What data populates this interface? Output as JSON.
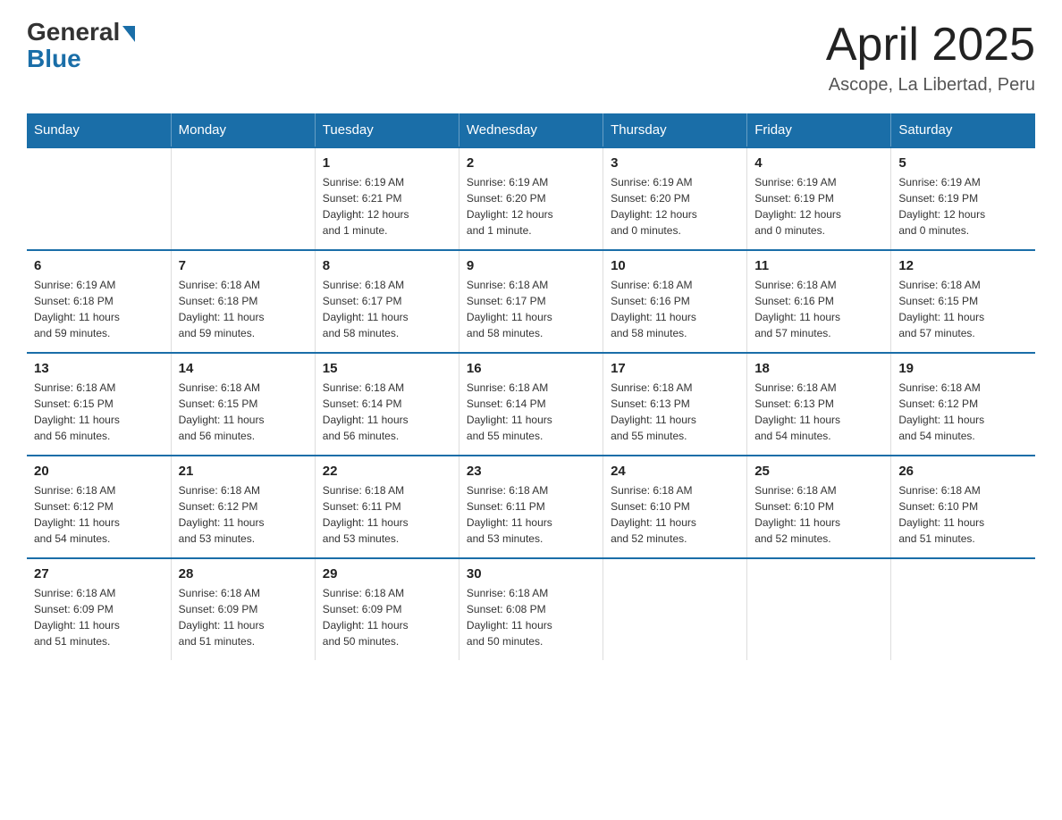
{
  "header": {
    "logo_general": "General",
    "logo_blue": "Blue",
    "month_title": "April 2025",
    "location": "Ascope, La Libertad, Peru"
  },
  "days_of_week": [
    "Sunday",
    "Monday",
    "Tuesday",
    "Wednesday",
    "Thursday",
    "Friday",
    "Saturday"
  ],
  "weeks": [
    [
      {
        "day": "",
        "info": ""
      },
      {
        "day": "",
        "info": ""
      },
      {
        "day": "1",
        "info": "Sunrise: 6:19 AM\nSunset: 6:21 PM\nDaylight: 12 hours\nand 1 minute."
      },
      {
        "day": "2",
        "info": "Sunrise: 6:19 AM\nSunset: 6:20 PM\nDaylight: 12 hours\nand 1 minute."
      },
      {
        "day": "3",
        "info": "Sunrise: 6:19 AM\nSunset: 6:20 PM\nDaylight: 12 hours\nand 0 minutes."
      },
      {
        "day": "4",
        "info": "Sunrise: 6:19 AM\nSunset: 6:19 PM\nDaylight: 12 hours\nand 0 minutes."
      },
      {
        "day": "5",
        "info": "Sunrise: 6:19 AM\nSunset: 6:19 PM\nDaylight: 12 hours\nand 0 minutes."
      }
    ],
    [
      {
        "day": "6",
        "info": "Sunrise: 6:19 AM\nSunset: 6:18 PM\nDaylight: 11 hours\nand 59 minutes."
      },
      {
        "day": "7",
        "info": "Sunrise: 6:18 AM\nSunset: 6:18 PM\nDaylight: 11 hours\nand 59 minutes."
      },
      {
        "day": "8",
        "info": "Sunrise: 6:18 AM\nSunset: 6:17 PM\nDaylight: 11 hours\nand 58 minutes."
      },
      {
        "day": "9",
        "info": "Sunrise: 6:18 AM\nSunset: 6:17 PM\nDaylight: 11 hours\nand 58 minutes."
      },
      {
        "day": "10",
        "info": "Sunrise: 6:18 AM\nSunset: 6:16 PM\nDaylight: 11 hours\nand 58 minutes."
      },
      {
        "day": "11",
        "info": "Sunrise: 6:18 AM\nSunset: 6:16 PM\nDaylight: 11 hours\nand 57 minutes."
      },
      {
        "day": "12",
        "info": "Sunrise: 6:18 AM\nSunset: 6:15 PM\nDaylight: 11 hours\nand 57 minutes."
      }
    ],
    [
      {
        "day": "13",
        "info": "Sunrise: 6:18 AM\nSunset: 6:15 PM\nDaylight: 11 hours\nand 56 minutes."
      },
      {
        "day": "14",
        "info": "Sunrise: 6:18 AM\nSunset: 6:15 PM\nDaylight: 11 hours\nand 56 minutes."
      },
      {
        "day": "15",
        "info": "Sunrise: 6:18 AM\nSunset: 6:14 PM\nDaylight: 11 hours\nand 56 minutes."
      },
      {
        "day": "16",
        "info": "Sunrise: 6:18 AM\nSunset: 6:14 PM\nDaylight: 11 hours\nand 55 minutes."
      },
      {
        "day": "17",
        "info": "Sunrise: 6:18 AM\nSunset: 6:13 PM\nDaylight: 11 hours\nand 55 minutes."
      },
      {
        "day": "18",
        "info": "Sunrise: 6:18 AM\nSunset: 6:13 PM\nDaylight: 11 hours\nand 54 minutes."
      },
      {
        "day": "19",
        "info": "Sunrise: 6:18 AM\nSunset: 6:12 PM\nDaylight: 11 hours\nand 54 minutes."
      }
    ],
    [
      {
        "day": "20",
        "info": "Sunrise: 6:18 AM\nSunset: 6:12 PM\nDaylight: 11 hours\nand 54 minutes."
      },
      {
        "day": "21",
        "info": "Sunrise: 6:18 AM\nSunset: 6:12 PM\nDaylight: 11 hours\nand 53 minutes."
      },
      {
        "day": "22",
        "info": "Sunrise: 6:18 AM\nSunset: 6:11 PM\nDaylight: 11 hours\nand 53 minutes."
      },
      {
        "day": "23",
        "info": "Sunrise: 6:18 AM\nSunset: 6:11 PM\nDaylight: 11 hours\nand 53 minutes."
      },
      {
        "day": "24",
        "info": "Sunrise: 6:18 AM\nSunset: 6:10 PM\nDaylight: 11 hours\nand 52 minutes."
      },
      {
        "day": "25",
        "info": "Sunrise: 6:18 AM\nSunset: 6:10 PM\nDaylight: 11 hours\nand 52 minutes."
      },
      {
        "day": "26",
        "info": "Sunrise: 6:18 AM\nSunset: 6:10 PM\nDaylight: 11 hours\nand 51 minutes."
      }
    ],
    [
      {
        "day": "27",
        "info": "Sunrise: 6:18 AM\nSunset: 6:09 PM\nDaylight: 11 hours\nand 51 minutes."
      },
      {
        "day": "28",
        "info": "Sunrise: 6:18 AM\nSunset: 6:09 PM\nDaylight: 11 hours\nand 51 minutes."
      },
      {
        "day": "29",
        "info": "Sunrise: 6:18 AM\nSunset: 6:09 PM\nDaylight: 11 hours\nand 50 minutes."
      },
      {
        "day": "30",
        "info": "Sunrise: 6:18 AM\nSunset: 6:08 PM\nDaylight: 11 hours\nand 50 minutes."
      },
      {
        "day": "",
        "info": ""
      },
      {
        "day": "",
        "info": ""
      },
      {
        "day": "",
        "info": ""
      }
    ]
  ]
}
